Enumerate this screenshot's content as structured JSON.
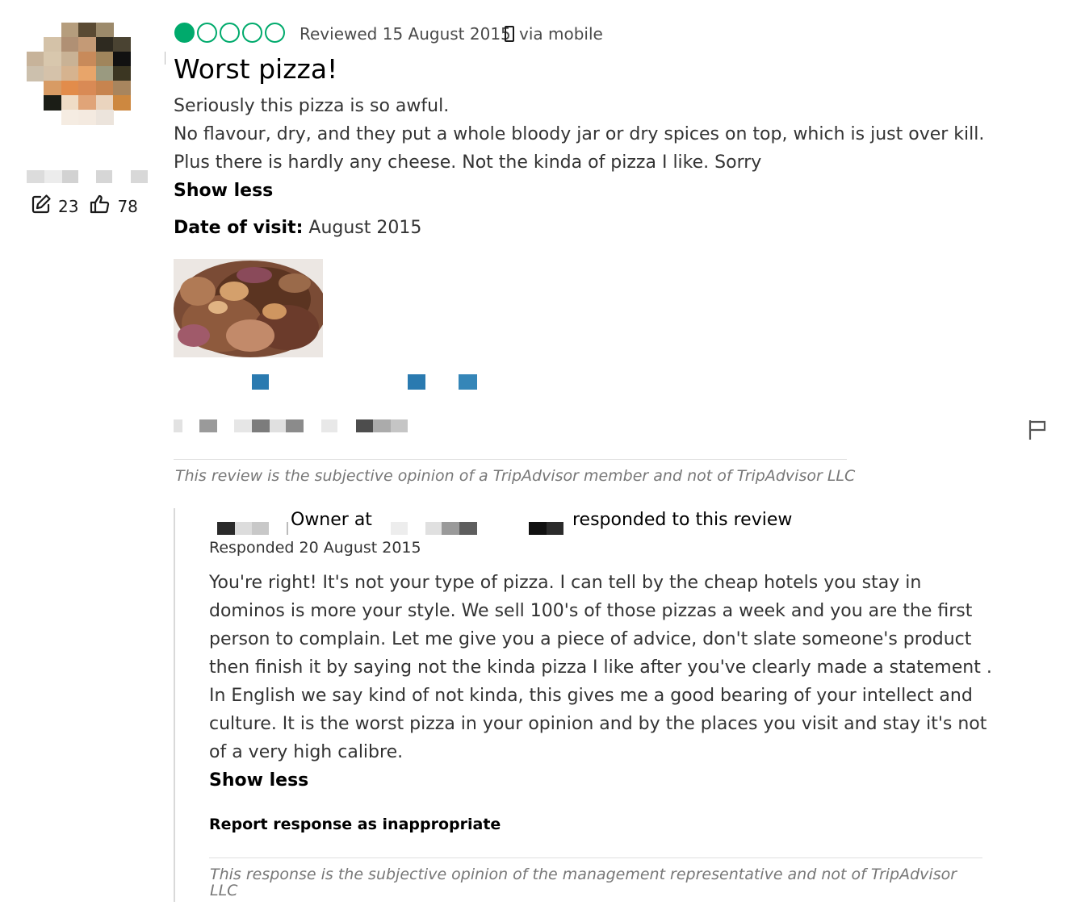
{
  "reviewer": {
    "review_count": "23",
    "helpful_votes": "78"
  },
  "review": {
    "bubble_rating": 1,
    "bubble_max": 5,
    "reviewed_date": "Reviewed 15 August 2015",
    "via": "via mobile",
    "title": "Worst pizza!",
    "lines": [
      "Seriously this pizza is so awful.",
      "No flavour, dry, and they put a whole bloody jar or dry spices on top, which is just over kill.",
      "Plus there is hardly any cheese. Not the kinda of pizza I like. Sorry"
    ],
    "show_less": "Show less",
    "visit_label": "Date of visit:",
    "visit_value": "August 2015",
    "disclaimer": "This review is the subjective opinion of a TripAdvisor member and not of TripAdvisor LLC"
  },
  "response": {
    "owner_prefix": "Owner at",
    "responded_suffix": "responded to this review",
    "responded_date": "Responded 20 August 2015",
    "text": "You're right! It's not your type of pizza. I can tell by the cheap hotels you stay in dominos is more your style. We sell 100's of those pizzas a week and you are the first person to complain. Let me give you a piece of advice, don't slate someone's product then finish it by saying not the kinda pizza I like after you've clearly made a statement . In English we say kind of not kinda, this gives me a good bearing of your intellect and culture. It is the worst pizza in your opinion and by the places you visit and stay it's not of a very high calibre.",
    "show_less": "Show less",
    "report": "Report response as inappropriate",
    "disclaimer": "This response is the subjective opinion of the management representative and not of TripAdvisor LLC"
  },
  "colors": {
    "bubble_green": "#00aa6c",
    "link_blue": "#2a7ab0"
  },
  "icons": [
    "edit-icon",
    "thumbs-up-icon",
    "mobile-phone-icon",
    "flag-icon"
  ]
}
